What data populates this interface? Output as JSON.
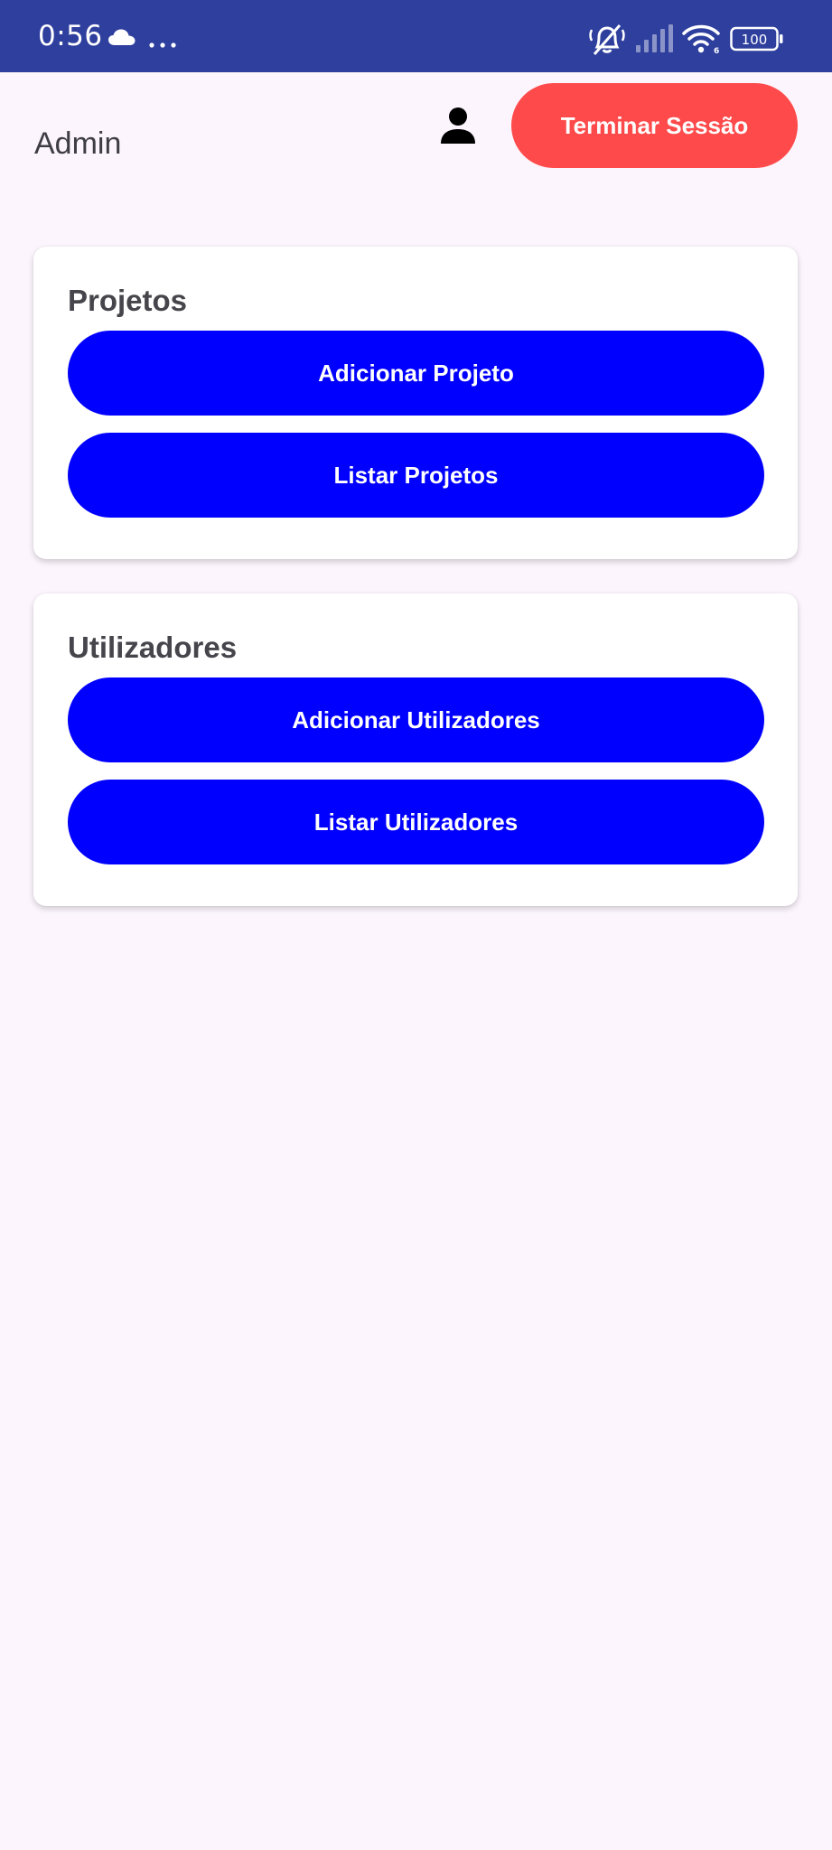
{
  "status_bar": {
    "time": "0:56",
    "battery_level": "100",
    "icons": [
      "cloud-icon",
      "more-dots-icon",
      "vibrate-off-icon",
      "signal-icon",
      "wifi-6-icon",
      "battery-icon"
    ]
  },
  "header": {
    "user_label": "Admin",
    "profile_icon": "person-icon",
    "logout_label": "Terminar Sessão"
  },
  "sections": [
    {
      "title": "Projetos",
      "buttons": [
        "Adicionar Projeto",
        "Listar Projetos"
      ]
    },
    {
      "title": "Utilizadores",
      "buttons": [
        "Adicionar Utilizadores",
        "Listar Utilizadores"
      ]
    }
  ],
  "colors": {
    "status_bar": "#2e3f9e",
    "background": "#fcf5fd",
    "logout_button": "#fe4a4a",
    "primary_button": "#0000fe",
    "text_dark": "#45454b"
  }
}
